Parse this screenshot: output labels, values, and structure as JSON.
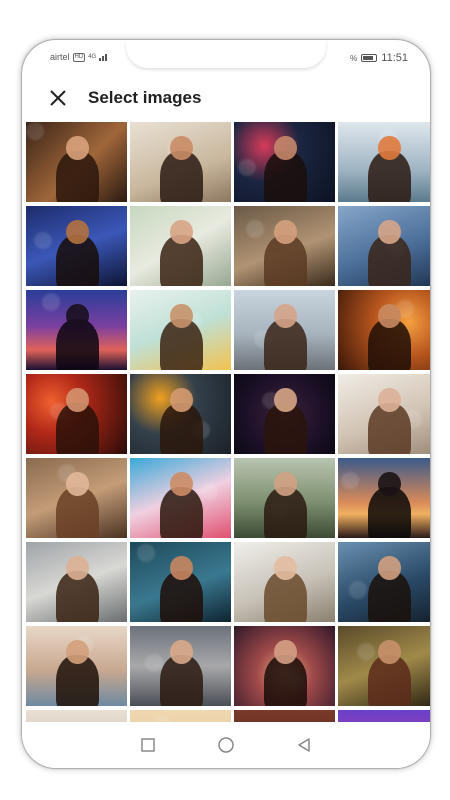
{
  "status": {
    "carrier": "airtel",
    "network_badge": "HD",
    "network_type": "4G",
    "battery_percent": "%",
    "time": "11:51"
  },
  "header": {
    "close_icon": "close-icon",
    "title": "Select images"
  },
  "gallery": {
    "images": [
      {
        "bg": "linear-gradient(135deg,#3a2418,#a0663a 55%,#2a1a10)",
        "skin": "#d9a27c",
        "hair": "#2b160c"
      },
      {
        "bg": "linear-gradient(160deg,#e9e1d5,#c9b79d 60%,#8c7760)",
        "skin": "#c98c66",
        "hair": "#2a1a12"
      },
      {
        "bg": "radial-gradient(circle at 30% 30%,#d63b5a 0,#1b2540 40%,#0c1222 100%)",
        "skin": "#c4876a",
        "hair": "#1a0e0a"
      },
      {
        "bg": "linear-gradient(180deg,#dfe6ec,#9fb4c4 60%,#5b7a8c)",
        "skin": "#e07a3e",
        "hair": "#2b1a12"
      },
      {
        "bg": "linear-gradient(160deg,#1d2b6b,#3b58b8 50%,#0e1434)",
        "skin": "#b2723f",
        "hair": "#170c08"
      },
      {
        "bg": "linear-gradient(150deg,#c7d8c0,#e8eadf 50%,#97a893)",
        "skin": "#d8a486",
        "hair": "#3a2212"
      },
      {
        "bg": "linear-gradient(160deg,#6a5846,#b09373 55%,#3a2a1c)",
        "skin": "#d4a07e",
        "hair": "#5a3a22"
      },
      {
        "bg": "linear-gradient(160deg,#87a6c8,#4b6f9a 55%,#1f3450)",
        "skin": "#d6a588",
        "hair": "#3a2418"
      },
      {
        "bg": "linear-gradient(180deg,#2a3e98,#7a3fa0 45%,#e0625a 75%,#1a1030)",
        "skin": "#1a1020",
        "hair": "#0a0610"
      },
      {
        "bg": "linear-gradient(160deg,#e9f1ef,#bfe0d6 50%,#f2c24f)",
        "skin": "#c8926c",
        "hair": "#3a2212"
      },
      {
        "bg": "linear-gradient(180deg,#c9d4de,#a7b3bd 55%,#6c7278)",
        "skin": "#d4a488",
        "hair": "#3a2418"
      },
      {
        "bg": "radial-gradient(circle at 70% 40%,#f5a040 0,#b8561e 40%,#3a1608 100%)",
        "skin": "#c88a60",
        "hair": "#1e0e06"
      },
      {
        "bg": "radial-gradient(circle at 25% 35%,#f06030 0,#b02818 35%,#2a0c08 100%)",
        "skin": "#d4946e",
        "hair": "#2a1008"
      },
      {
        "bg": "radial-gradient(circle at 30% 30%,#f0a020 0,#34404a 40%,#1a2028 100%)",
        "skin": "#d49a70",
        "hair": "#2a160c"
      },
      {
        "bg": "radial-gradient(circle at 50% 50%,#3a2238 0,#1c1028 60%,#0c0814 100%)",
        "skin": "#d6a686",
        "hair": "#2a140c"
      },
      {
        "bg": "linear-gradient(160deg,#f0ece6,#d2c4b4 55%,#9c8a78)",
        "skin": "#dcb098",
        "hair": "#5a3a24"
      },
      {
        "bg": "linear-gradient(160deg,#8a6a4e,#c49c78 50%,#4a3222)",
        "skin": "#e0b898",
        "hair": "#6a4024"
      },
      {
        "bg": "linear-gradient(160deg,#3aa8d8,#f0d0e0 50%,#e05070)",
        "skin": "#cc8c66",
        "hair": "#2a160c"
      },
      {
        "bg": "linear-gradient(180deg,#b8c4b0,#7e9070 55%,#3c4a34)",
        "skin": "#d0a282",
        "hair": "#2a1a10"
      },
      {
        "bg": "linear-gradient(180deg,#3c5a8a,#d88a5a 55%,#f0b060 70%,#2a1a18)",
        "skin": "#1a1214",
        "hair": "#0a0808"
      },
      {
        "bg": "linear-gradient(160deg,#a0a4a8,#d8d8d4 50%,#6a6e70)",
        "skin": "#dcb094",
        "hair": "#3a2212"
      },
      {
        "bg": "linear-gradient(160deg,#1e4a5a,#3a7890 55%,#0e2430)",
        "skin": "#c88660",
        "hair": "#1e0e08"
      },
      {
        "bg": "linear-gradient(160deg,#f0efea,#c8c2b8 55%,#8a8070)",
        "skin": "#e2bca0",
        "hair": "#6a4a2c"
      },
      {
        "bg": "linear-gradient(160deg,#6a90b0,#2a4a68 55%,#14202c)",
        "skin": "#d0a080",
        "hair": "#1a100a"
      },
      {
        "bg": "linear-gradient(180deg,#e8d8c8,#c8a890 55%,#6e8aa0)",
        "skin": "#d4a07c",
        "hair": "#1e1008"
      },
      {
        "bg": "linear-gradient(180deg,#6c727c,#a8a8aa 50%,#4a4e56)",
        "skin": "#d8a888",
        "hair": "#2a1a10"
      },
      {
        "bg": "radial-gradient(circle at 50% 60%,#e8a880 0,#a04a4a 40%,#301828 100%)",
        "skin": "#d4a084",
        "hair": "#1a0c08"
      },
      {
        "bg": "linear-gradient(160deg,#5a4a2a,#a08a4a 50%,#2a2212)",
        "skin": "#c8906a",
        "hair": "#5a2a1a"
      },
      {
        "bg": "linear-gradient(180deg,#e8e0d4,#c0a88e)",
        "skin": "#d8a888",
        "hair": "#3a2216"
      },
      {
        "bg": "linear-gradient(180deg,#f0d8b0,#d8b890)",
        "skin": "#e0b898",
        "hair": "#8a5a30"
      },
      {
        "bg": "linear-gradient(180deg,#7a3a2a,#3a1a14)",
        "skin": "#d09c7a",
        "hair": "#1a0c08"
      },
      {
        "bg": "linear-gradient(180deg,#6a40c8,#e040a0)",
        "skin": "#e8a0d0",
        "hair": "#40208a"
      }
    ]
  },
  "navbar": {
    "back_icon": "back-icon",
    "home_icon": "home-icon",
    "recents_icon": "recents-icon"
  }
}
